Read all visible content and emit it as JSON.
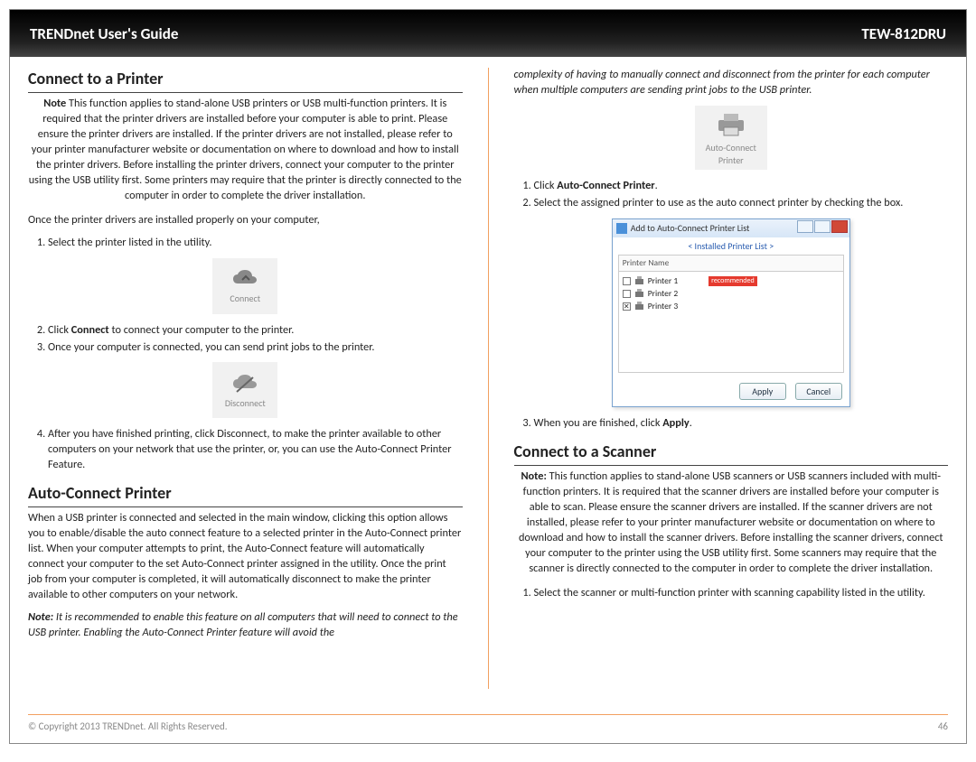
{
  "header": {
    "left": "TRENDnet User's Guide",
    "right": "TEW-812DRU"
  },
  "left_col": {
    "h_printer": "Connect to a Printer",
    "note_label": "Note",
    "note_printer": " This function applies to stand-alone USB printers or USB multi-function printers. It is required that the printer drivers are installed before your computer is able to print. Please ensure the printer drivers are installed. If the printer drivers are not installed, please refer to your printer manufacturer website or documentation on where to download and how to install the printer drivers. Before installing the printer drivers, connect your computer to the printer using the USB utility first. Some printers may require that the printer is directly connected to the computer in order to complete the driver installation.",
    "intro": "Once the printer drivers are installed properly on your computer,",
    "step1": "Select the printer listed in the utility.",
    "connect_icon_label": "Connect",
    "step2_pre": "Click ",
    "step2_bold": "Connect",
    "step2_post": " to connect your computer to the printer.",
    "step3": "Once your computer is connected, you can send print jobs to the printer.",
    "disconnect_icon_label": "Disconnect",
    "step4": "After you have finished printing, click Disconnect, to make the printer available to other computers on your network that use the printer, or, you can use the Auto-Connect Printer Feature.",
    "h_autoconnect": "Auto-Connect Printer",
    "autoconnect_para": "When a USB printer is connected and selected in the main window, clicking this option allows you to enable/disable the auto connect feature to a selected printer in the Auto-Connect printer list. When your computer attempts to print, the Auto-Connect feature will automatically connect your computer to the set Auto-Connect printer assigned in the utility. Once the print job from your computer is completed, it will automatically disconnect to make the printer available to other computers on your network.",
    "autoconnect_note_label": "Note:",
    "autoconnect_note": " It is recommended to enable this feature on all computers that will need to connect to the USB printer. Enabling the Auto-Connect Printer feature will avoid the"
  },
  "right_col": {
    "continuation": "complexity of having to manually connect and disconnect from the printer for each computer when multiple computers are sending print jobs to the USB printer.",
    "acp_icon_line1": "Auto-Connect",
    "acp_icon_line2": "Printer",
    "r_step1_pre": "Click ",
    "r_step1_bold": "Auto-Connect Printer",
    "r_step1_post": ".",
    "r_step2": "Select the assigned printer to use as the auto connect printer by checking the box.",
    "dialog": {
      "title": "Add to Auto-Connect Printer List",
      "subtitle": "< Installed Printer List >",
      "col_header": "Printer Name",
      "rows": [
        {
          "checked": false,
          "name": "Printer 1",
          "recommended": true
        },
        {
          "checked": false,
          "name": "Printer 2",
          "recommended": false
        },
        {
          "checked": true,
          "name": "Printer 3",
          "recommended": false
        }
      ],
      "recommended_label": "recommended",
      "btn_apply": "Apply",
      "btn_cancel": "Cancel"
    },
    "r_step3_pre": "When you are finished, click ",
    "r_step3_bold": "Apply",
    "r_step3_post": ".",
    "h_scanner": "Connect to a Scanner",
    "scanner_note_label": "Note:",
    "scanner_note": " This function applies to stand-alone USB scanners or USB scanners included with multi-function printers. It is required that the scanner drivers are installed before your computer is able to scan. Please ensure the scanner drivers are installed. If the scanner drivers are not installed, please refer to your printer manufacturer website or documentation on where to download and how to install the scanner drivers. Before installing the scanner drivers, connect your computer to the printer using the USB utility first. Some scanners may require that the scanner is directly connected to the computer in order to complete the driver installation.",
    "scan_step1": "Select the scanner or multi-function printer with scanning capability listed in the utility."
  },
  "footer": {
    "copyright": "© Copyright 2013 TRENDnet. All Rights Reserved.",
    "page_no": "46"
  }
}
